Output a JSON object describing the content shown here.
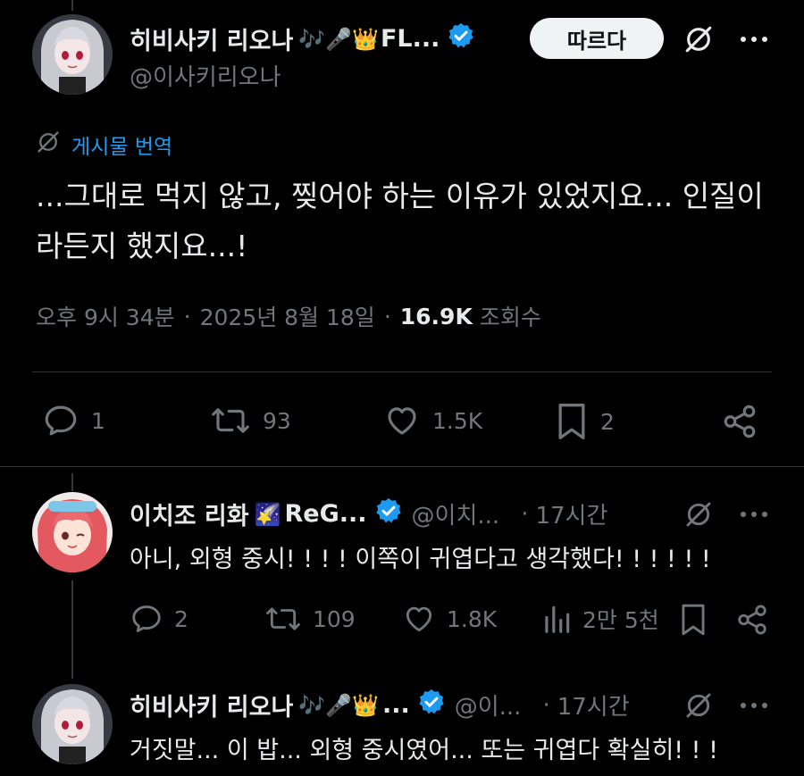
{
  "main_post": {
    "author_name": "히비사키 리오나",
    "author_emoji": "🎶🎤👑",
    "author_suffix": "FL...",
    "handle": "@이사키리오나",
    "follow_label": "따르다",
    "translate_label": "게시물 번역",
    "text": "...그대로 먹지 않고, 찢어야 하는 이유가 있었지요... 인질이라든지 했지요...!",
    "time": "오후 9시 34분",
    "date": "2025년 8월 18일",
    "views_count": "16.9K",
    "views_label": "조회수",
    "stats": {
      "replies": "1",
      "reposts": "93",
      "likes": "1.5K",
      "bookmarks": "2"
    }
  },
  "replies": [
    {
      "author_name": "이치조 리화",
      "author_emoji": "🌠",
      "author_suffix": "ReG...",
      "handle": "@이치...",
      "time": "17시간",
      "text": "아니, 외형 중시! ! ! ! 이쪽이 귀엽다고 생각했다! ! ! ! ! !",
      "stats": {
        "replies": "2",
        "reposts": "109",
        "likes": "1.8K",
        "views": "2만 5천"
      }
    },
    {
      "author_name": "히비사키 리오나",
      "author_emoji": "🎶🎤👑",
      "author_suffix": "...",
      "handle": "@이...",
      "time": "17시간",
      "text": "거짓말... 이 밥... 외형 중시였어... 또는 귀엽다 확실히! ! !"
    }
  ],
  "colors": {
    "accent": "#1d9bf0",
    "muted": "#71767b",
    "text": "#e7e9ea",
    "background": "#000000"
  },
  "icons": [
    "verified-badge-icon",
    "grok-icon",
    "more-icon",
    "reply-icon",
    "repost-icon",
    "like-icon",
    "bookmark-icon",
    "share-icon",
    "views-icon"
  ]
}
